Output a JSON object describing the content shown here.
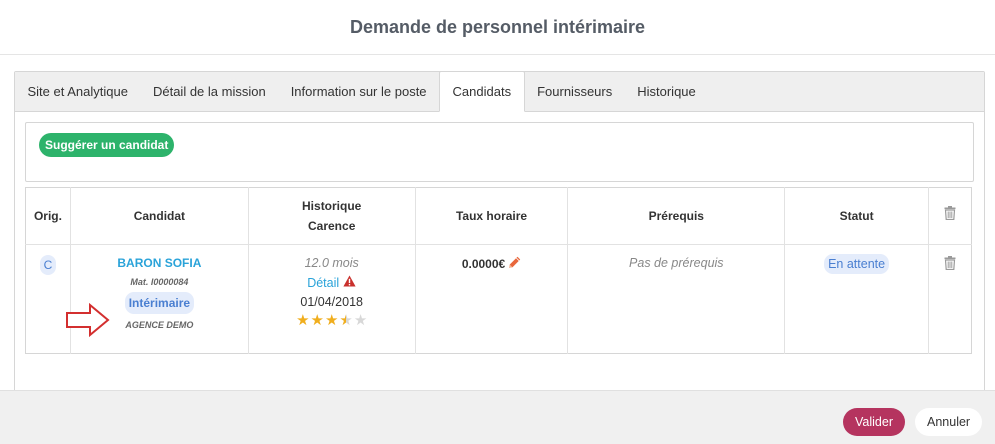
{
  "header": {
    "title": "Demande de personnel intérimaire"
  },
  "tabs": [
    {
      "label": "Site et Analytique",
      "active": false
    },
    {
      "label": "Détail de la mission",
      "active": false
    },
    {
      "label": "Information sur le poste",
      "active": false
    },
    {
      "label": "Candidats",
      "active": true
    },
    {
      "label": "Fournisseurs",
      "active": false
    },
    {
      "label": "Historique",
      "active": false
    }
  ],
  "suggest": {
    "label": "Suggérer un candidat"
  },
  "table": {
    "headers": {
      "orig": "Orig.",
      "candidat": "Candidat",
      "historique_line1": "Historique",
      "historique_line2": "Carence",
      "taux": "Taux horaire",
      "prerequis": "Prérequis",
      "statut": "Statut"
    },
    "row": {
      "orig": "C",
      "name": "BARON SOFIA",
      "matricule": "Mat. I0000084",
      "type": "Intérimaire",
      "agency": "AGENCE DEMO",
      "duree": "12.0 mois",
      "detail": "Détail",
      "date": "01/04/2018",
      "rating": 3.5,
      "rating_max": 5,
      "taux": "0.0000€",
      "prerequis": "Pas de prérequis",
      "statut": "En attente"
    }
  },
  "footer": {
    "validate": "Valider",
    "cancel": "Annuler"
  },
  "colors": {
    "accent_green": "#2db36b",
    "accent_link": "#2aa3d9",
    "validate": "#b5345f",
    "star": "#f0ae1e",
    "warning": "#c9302c",
    "arrow": "#d32f2f",
    "pencil": "#e8673c"
  },
  "icons": {
    "trash": "trash-icon",
    "warning": "warning-icon",
    "edit": "pencil-icon",
    "star": "star-icon",
    "arrow": "arrow-right-icon"
  }
}
